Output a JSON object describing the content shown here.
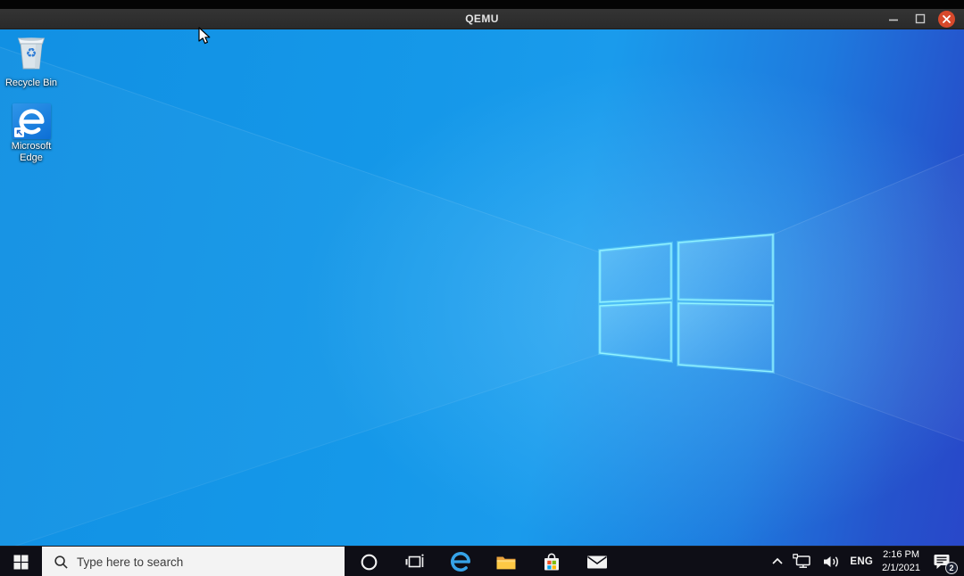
{
  "window": {
    "title": "QEMU"
  },
  "desktop": {
    "icons": [
      {
        "name": "recycle-bin",
        "label": "Recycle Bin",
        "icon": "recycle-bin-icon"
      },
      {
        "name": "microsoft-edge",
        "label": "Microsoft Edge",
        "icon": "edge-e-icon"
      }
    ]
  },
  "taskbar": {
    "search": {
      "placeholder": "Type here to search",
      "icon": "search-icon"
    },
    "apps": [
      {
        "name": "cortana",
        "icon": "cortana-circle-icon"
      },
      {
        "name": "task-view",
        "icon": "task-view-icon"
      },
      {
        "name": "edge",
        "icon": "edge-e-icon"
      },
      {
        "name": "file-explorer",
        "icon": "folder-icon"
      },
      {
        "name": "microsoft-store",
        "icon": "store-bag-icon"
      },
      {
        "name": "mail",
        "icon": "envelope-icon"
      }
    ],
    "tray": {
      "language": "ENG",
      "time": "2:16 PM",
      "date": "2/1/2021",
      "notification_count": "2"
    }
  },
  "colors": {
    "titlebar_bg": "#2e2e2e",
    "close_button": "#d8492b",
    "wallpaper_azure": "#1598e9",
    "wallpaper_royal": "#2847c9",
    "logo_glow": "#7ef0ff",
    "taskbar_bg": "#0e0e16",
    "search_box_bg": "#f3f3f3",
    "edge_blue": "#36a3e8",
    "folder_yellow": "#fdc945",
    "store_red": "#f25022",
    "store_green": "#7fba00",
    "store_blue": "#00a4ef",
    "store_yellow": "#ffb900",
    "recycle_symbol_blue": "#2e7cd6"
  }
}
